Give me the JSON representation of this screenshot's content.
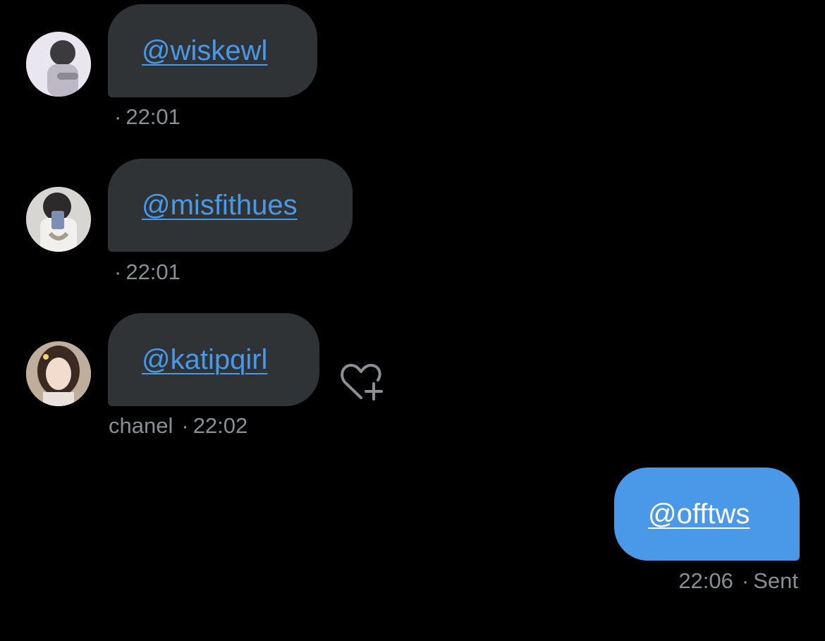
{
  "messages": [
    {
      "handle": "@wiskewl",
      "sender": "",
      "time": "22:01",
      "avatar_desc": "profile-photo"
    },
    {
      "handle": "@misfithues",
      "sender": "",
      "time": "22:01",
      "avatar_desc": "profile-photo"
    },
    {
      "handle": "@katipqirl",
      "sender": "chanel",
      "time": "22:02",
      "avatar_desc": "profile-photo"
    }
  ],
  "sent": {
    "handle": "@offtws",
    "time": "22:06",
    "status": "Sent"
  },
  "separator": "·",
  "icons": {
    "react": "heart-plus-icon"
  },
  "colors": {
    "background": "#000000",
    "received_bubble": "#2f3336",
    "sent_bubble": "#4a99e9",
    "link": "#4a99e9",
    "meta_text": "#8b8f94"
  }
}
